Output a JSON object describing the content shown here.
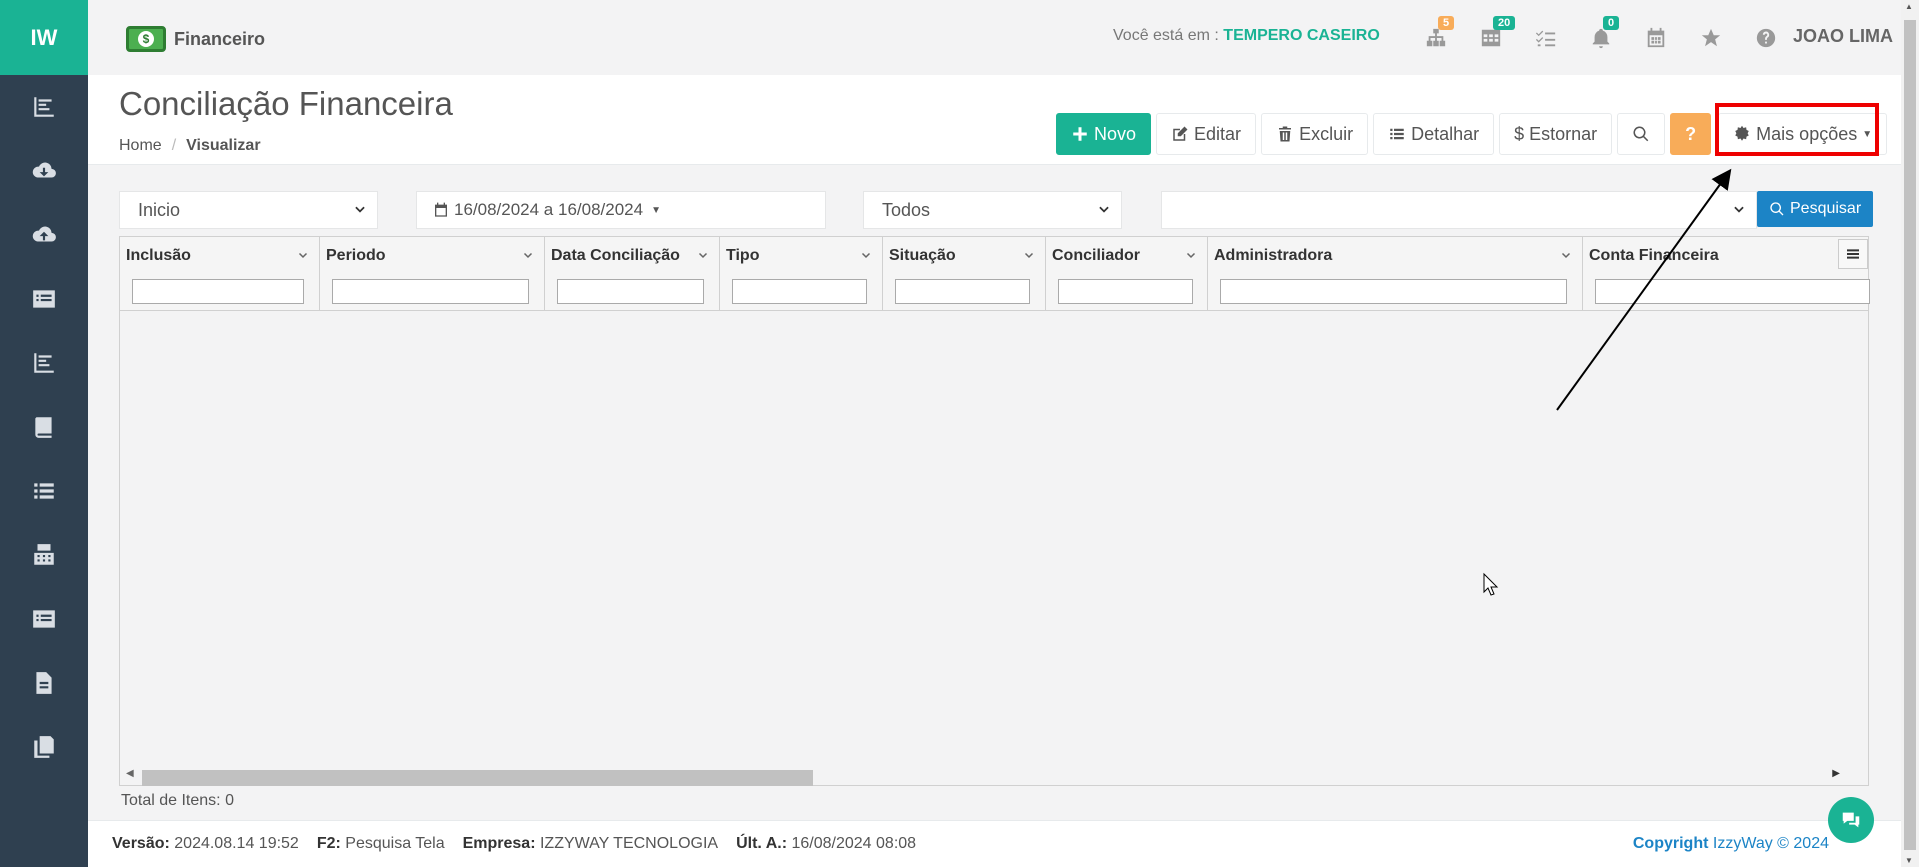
{
  "sidebar": {
    "brand": "IW",
    "items": [
      {
        "icon": "chart-bar-icon"
      },
      {
        "icon": "cloud-download-icon"
      },
      {
        "icon": "cloud-upload-icon"
      },
      {
        "icon": "list-alt-icon"
      },
      {
        "icon": "chart-bar-icon"
      },
      {
        "icon": "book-icon"
      },
      {
        "icon": "list-icon"
      },
      {
        "icon": "calculator-icon"
      },
      {
        "icon": "list-alt-icon"
      },
      {
        "icon": "file-text-icon"
      },
      {
        "icon": "copy-icon"
      }
    ]
  },
  "topbar": {
    "module": "Financeiro",
    "context_label": "Você está em :",
    "context_value": "TEMPERO CASEIRO",
    "icons": [
      {
        "icon": "sitemap-icon",
        "badge": "5",
        "badge_color": "#f8ac59"
      },
      {
        "icon": "table-icon",
        "badge": "20",
        "badge_color": "#1ab394"
      },
      {
        "icon": "tasks-icon",
        "badge": ""
      },
      {
        "icon": "bell-icon",
        "badge": "0",
        "badge_color": "#1ab394"
      },
      {
        "icon": "calendar-icon",
        "badge": ""
      },
      {
        "icon": "star-icon",
        "badge": ""
      },
      {
        "icon": "question-circle-icon",
        "badge": ""
      }
    ],
    "user": "JOAO LIMA"
  },
  "header": {
    "title": "Conciliação Financeira",
    "breadcrumb": [
      "Home",
      "Visualizar"
    ],
    "toolbar": {
      "new": "Novo",
      "edit": "Editar",
      "delete": "Excluir",
      "detail": "Detalhar",
      "reverse": "Estornar",
      "help": "?",
      "more": "Mais opções"
    }
  },
  "filters": {
    "field": "Inicio",
    "date_range": "16/08/2024 a 16/08/2024",
    "status": "Todos",
    "extra": "",
    "search": "Pesquisar"
  },
  "grid": {
    "columns": [
      "Inclusão",
      "Periodo",
      "Data Conciliação",
      "Tipo",
      "Situação",
      "Conciliador",
      "Administradora",
      "Conta Financeira"
    ],
    "rows": [],
    "total": "Total de Itens: 0"
  },
  "footer": {
    "version_label": "Versão:",
    "version": "2024.08.14 19:52",
    "f2_label": "F2:",
    "f2": "Pesquisa Tela",
    "company_label": "Empresa:",
    "company": "IZZYWAY TECNOLOGIA",
    "last_label": "Últ. A.:",
    "last": "16/08/2024 08:08",
    "copyright_label": "Copyright",
    "copyright": "IzzyWay © 2024"
  },
  "colors": {
    "sidebar": "#2f4050",
    "brand": "#1ab394",
    "primary": "#1ab394",
    "info": "#1c84c6",
    "warning": "#f8ac59",
    "highlight": "#ee0000"
  }
}
